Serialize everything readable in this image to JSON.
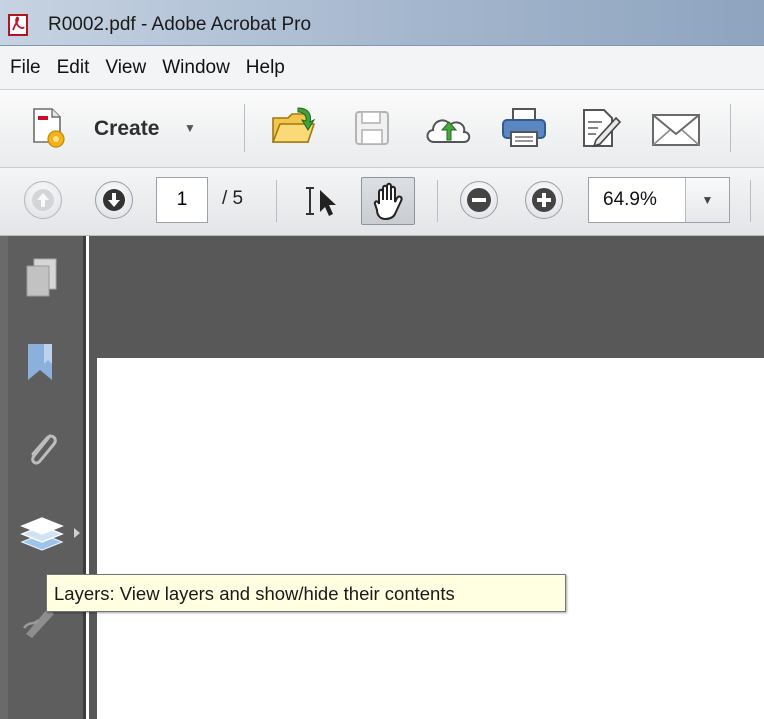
{
  "window": {
    "title": "R0002.pdf - Adobe Acrobat Pro",
    "icon": "pdf-file-icon"
  },
  "menu": {
    "items": [
      "File",
      "Edit",
      "View",
      "Window",
      "Help"
    ]
  },
  "toolbar": {
    "create_label": "Create",
    "icons": [
      "create-doc-icon",
      "open-folder-icon",
      "save-icon",
      "cloud-upload-icon",
      "print-icon",
      "edit-doc-icon",
      "email-icon"
    ]
  },
  "nav_toolbar": {
    "current_page": "1",
    "total_pages": "/ 5",
    "zoom": "64.9%",
    "active_tool": "hand-tool",
    "icons": [
      "prev-page-icon",
      "next-page-icon",
      "select-tool-icon",
      "hand-tool-icon",
      "zoom-out-icon",
      "zoom-in-icon",
      "chevron-down-icon"
    ]
  },
  "sidenav": {
    "icons": [
      "pages-icon",
      "bookmark-icon",
      "attachment-icon",
      "layers-icon",
      "signatures-icon"
    ]
  },
  "tooltip": {
    "text": "Layers: View layers and show/hide their contents"
  },
  "colors": {
    "doc_background": "#585858",
    "sidenav_background": "#5e5e5e",
    "tooltip_background": "#ffffe1",
    "pdf_red": "#c8102e"
  }
}
